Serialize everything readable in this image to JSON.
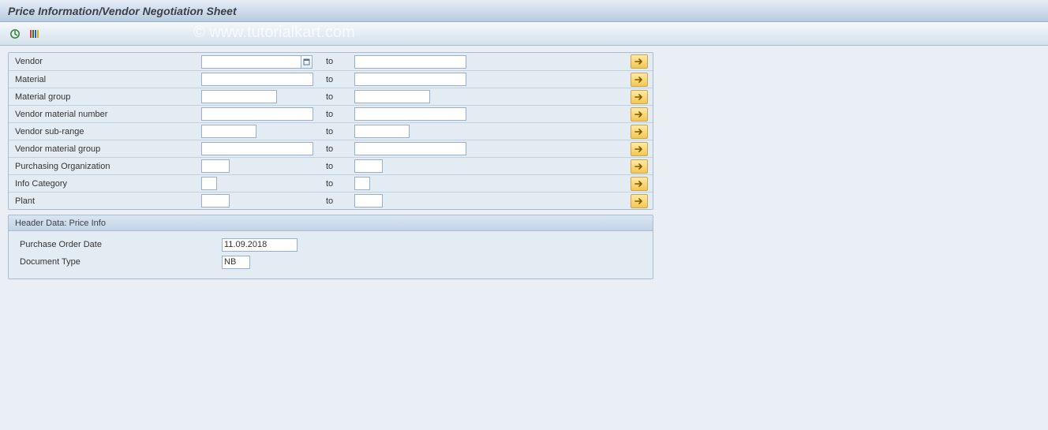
{
  "header": {
    "title": "Price Information/Vendor Negotiation Sheet"
  },
  "watermark": "© www.tutorialkart.com",
  "selection": {
    "to_label": "to",
    "rows": [
      {
        "label": "Vendor",
        "from": "",
        "to": "",
        "from_width": "w-full",
        "to_width": "w-full",
        "has_f4": true
      },
      {
        "label": "Material",
        "from": "",
        "to": "",
        "from_width": "w-full",
        "to_width": "w-full",
        "has_f4": false
      },
      {
        "label": "Material group",
        "from": "",
        "to": "",
        "from_width": "w-100",
        "to_width": "w-100",
        "has_f4": false
      },
      {
        "label": "Vendor material number",
        "from": "",
        "to": "",
        "from_width": "w-full",
        "to_width": "w-full",
        "has_f4": false
      },
      {
        "label": "Vendor sub-range",
        "from": "",
        "to": "",
        "from_width": "w-80",
        "to_width": "w-80",
        "has_f4": false
      },
      {
        "label": "Vendor material group",
        "from": "",
        "to": "",
        "from_width": "w-full",
        "to_width": "w-full",
        "has_f4": false
      },
      {
        "label": "Purchasing Organization",
        "from": "",
        "to": "",
        "from_width": "w-40",
        "to_width": "w-40",
        "has_f4": false
      },
      {
        "label": "Info Category",
        "from": "",
        "to": "",
        "from_width": "w-24",
        "to_width": "w-24",
        "has_f4": false
      },
      {
        "label": "Plant",
        "from": "",
        "to": "",
        "from_width": "w-40",
        "to_width": "w-40",
        "has_f4": false
      }
    ]
  },
  "group": {
    "title": "Header Data: Price Info",
    "fields": {
      "po_date_label": "Purchase Order Date",
      "po_date_value": "11.09.2018",
      "doc_type_label": "Document Type",
      "doc_type_value": "NB"
    }
  }
}
